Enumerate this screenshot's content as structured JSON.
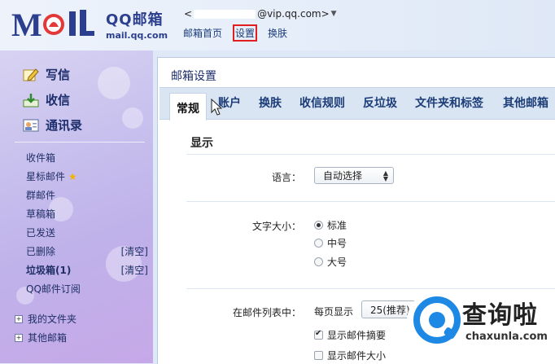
{
  "header": {
    "logo_title": "QQ邮箱",
    "logo_sub": "mail.qq.com",
    "email_prefix": "<",
    "email_suffix": "@vip.qq.com>",
    "email_arrow": "▼",
    "links": [
      {
        "label": "邮箱首页"
      },
      {
        "label": "设置"
      },
      {
        "label": "换肤"
      }
    ]
  },
  "sidebar": {
    "actions": [
      {
        "label": "写信",
        "icon": "pencil-icon"
      },
      {
        "label": "收信",
        "icon": "inbox-download-icon"
      },
      {
        "label": "通讯录",
        "icon": "contact-card-icon"
      }
    ],
    "folders": [
      {
        "label": "收件箱"
      },
      {
        "label": "星标邮件"
      },
      {
        "label": "群邮件"
      },
      {
        "label": "草稿箱"
      },
      {
        "label": "已发送"
      },
      {
        "label": "已删除",
        "action": "[清空]"
      },
      {
        "label": "垃圾箱(1)",
        "action": "[清空]"
      },
      {
        "label": "QQ邮件订阅"
      }
    ],
    "tree": [
      {
        "label": "我的文件夹"
      },
      {
        "label": "其他邮箱"
      }
    ]
  },
  "main": {
    "title": "邮箱设置",
    "tabs": [
      {
        "label": "常规"
      },
      {
        "label": "账户"
      },
      {
        "label": "换肤"
      },
      {
        "label": "收信规则"
      },
      {
        "label": "反垃圾"
      },
      {
        "label": "文件夹和标签"
      },
      {
        "label": "其他邮箱"
      }
    ],
    "section_display": "显示",
    "language_label": "语言：",
    "language_value": "自动选择",
    "font_size_label": "文字大小：",
    "font_size_options": [
      "标准",
      "中号",
      "大号"
    ],
    "list_label": "在邮件列表中：",
    "per_page_label": "每页显示",
    "per_page_value": "25(推荐)",
    "show_summary": "显示邮件摘要",
    "show_size": "显示邮件大小"
  },
  "watermark": {
    "title": "查询啦",
    "sub": "chaxunla.com"
  },
  "colors": {
    "brand_blue": "#1c2d6b",
    "highlight_red": "#e02020",
    "watermark_blue": "#1e88e5"
  }
}
